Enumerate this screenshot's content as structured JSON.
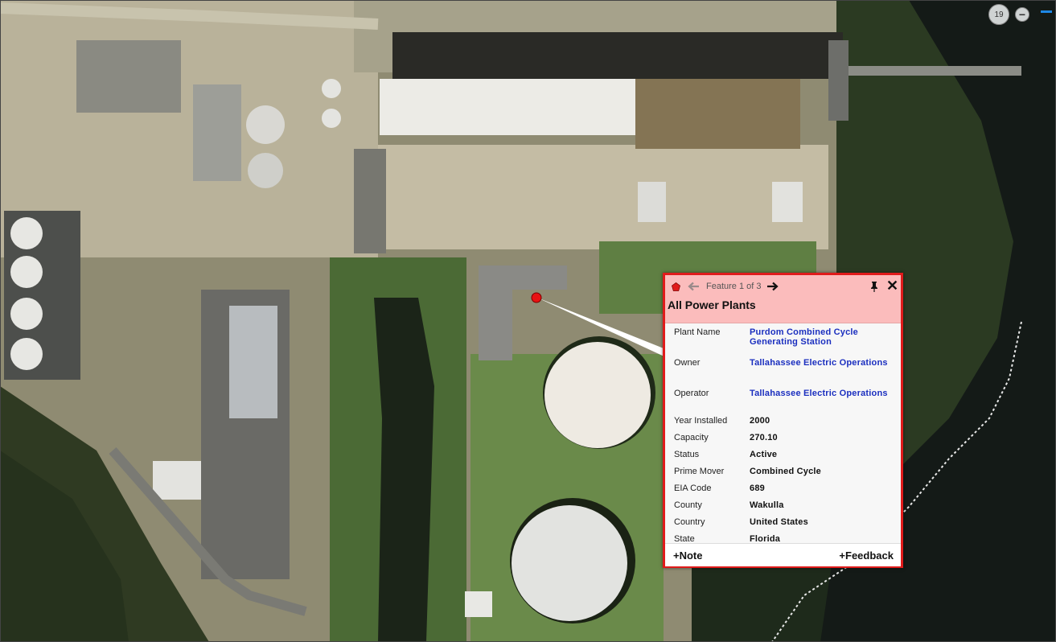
{
  "map": {
    "zoom_level": "19",
    "zoom_out_label": "−"
  },
  "popup": {
    "feature_nav": "Feature 1 of 3",
    "title": "All Power Plants",
    "close_label": "✕",
    "attributes": [
      {
        "label": "Plant Name",
        "value": "Purdom Combined Cycle Generating Station"
      },
      {
        "label": "Owner",
        "value": "Tallahassee Electric Operations"
      },
      {
        "label": "Operator",
        "value": "Tallahassee Electric Operations"
      },
      {
        "label": "Year Installed",
        "value": "2000"
      },
      {
        "label": "Capacity",
        "value": "270.10"
      },
      {
        "label": "Status",
        "value": "Active"
      },
      {
        "label": "Prime Mover",
        "value": "Combined Cycle"
      },
      {
        "label": "EIA Code",
        "value": "689"
      },
      {
        "label": "County",
        "value": "Wakulla"
      },
      {
        "label": "Country",
        "value": "United States"
      },
      {
        "label": "State",
        "value": "Florida"
      }
    ],
    "note_label": "+Note",
    "feedback_label": "+Feedback"
  },
  "colors": {
    "popup_border": "#e01b1b",
    "popup_header": "#fbbcbc",
    "link_text": "#1b2fbf",
    "marker": "#e81212"
  }
}
